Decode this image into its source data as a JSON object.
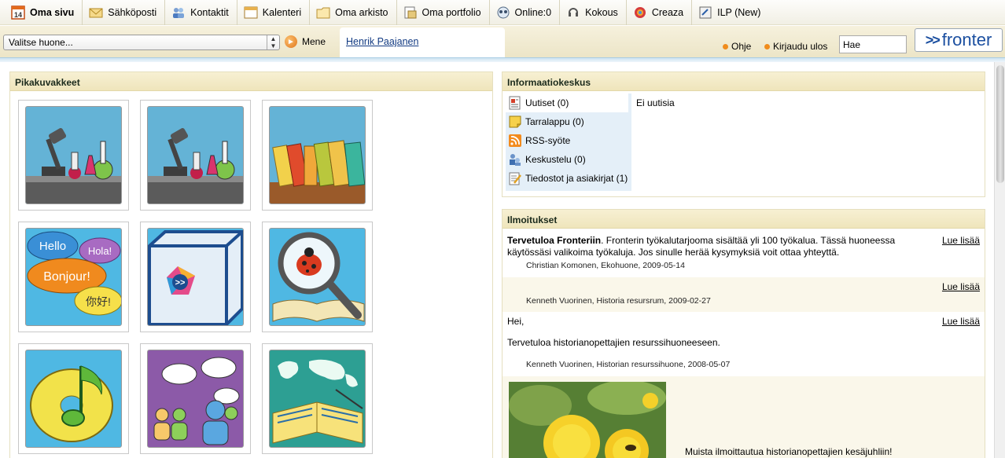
{
  "nav": {
    "items": [
      {
        "label": "Oma sivu",
        "icon": "calendar-day-icon",
        "badge": "14"
      },
      {
        "label": "Sähköposti",
        "icon": "mail-icon"
      },
      {
        "label": "Kontaktit",
        "icon": "contacts-icon"
      },
      {
        "label": "Kalenteri",
        "icon": "calendar-icon"
      },
      {
        "label": "Oma arkisto",
        "icon": "folder-icon"
      },
      {
        "label": "Oma portfolio",
        "icon": "portfolio-icon"
      },
      {
        "label": "Online:0",
        "icon": "online-icon"
      },
      {
        "label": "Kokous",
        "icon": "meeting-icon"
      },
      {
        "label": "Creaza",
        "icon": "creaza-icon"
      },
      {
        "label": "ILP (New)",
        "icon": "ilp-icon"
      }
    ]
  },
  "toolbar": {
    "room_select": "Valitse huone...",
    "go_label": "Mene",
    "user_name": "Henrik Paajanen",
    "help_label": "Ohje",
    "logout_label": "Kirjaudu ulos",
    "search_value": "Hae",
    "logo_text": "fronter",
    "logo_chevrons": ">>"
  },
  "quick": {
    "title": "Pikakuvakkeet",
    "tiles": [
      {
        "name": "microscope-lab-tile"
      },
      {
        "name": "microscope-lab-tile-2"
      },
      {
        "name": "books-tile"
      },
      {
        "name": "languages-tile",
        "words": [
          "Hello",
          "Hola!",
          "Bonjour!",
          "你好!"
        ]
      },
      {
        "name": "fronter-box-tile",
        "chevrons": ">>"
      },
      {
        "name": "ladybug-magnifier-tile"
      },
      {
        "name": "music-disc-tile"
      },
      {
        "name": "discussion-people-tile"
      },
      {
        "name": "world-map-book-tile"
      }
    ]
  },
  "info": {
    "title": "Informaatiokeskus",
    "items": [
      {
        "label": "Uutiset (0)",
        "icon": "news-icon"
      },
      {
        "label": "Tarralappu (0)",
        "icon": "sticky-note-icon"
      },
      {
        "label": "RSS-syöte",
        "icon": "rss-icon"
      },
      {
        "label": "Keskustelu (0)",
        "icon": "discussion-icon"
      },
      {
        "label": "Tiedostot ja asiakirjat (1)",
        "icon": "documents-icon"
      }
    ],
    "empty_text": "Ei uutisia"
  },
  "notices": {
    "title": "Ilmoitukset",
    "read_more": "Lue lisää",
    "items": [
      {
        "text_bold": "Tervetuloa Fronteriin",
        "text": ". Fronterin työkalutarjooma sisältää yli 100 työkalua. Tässä huoneessa käytössäsi valikoima työkaluja. Jos sinulle herää kysymyksiä voit ottaa yhteyttä.",
        "meta": "Christian Komonen,  Ekohuone,  2009-05-14"
      },
      {
        "text": "",
        "meta": "Kenneth Vuorinen,  Historia resursrum,  2009-02-27"
      },
      {
        "text_line1": "Hei,",
        "text_line2": "Tervetuloa historianopettajien resurssihuoneeseen.",
        "meta": "Kenneth Vuorinen,  Historian resurssihuone,  2008-05-07"
      },
      {
        "text": "Muista ilmoittautua historianopettajien kesäjuhliin!",
        "image": "dandelion-bee-photo"
      }
    ]
  }
}
